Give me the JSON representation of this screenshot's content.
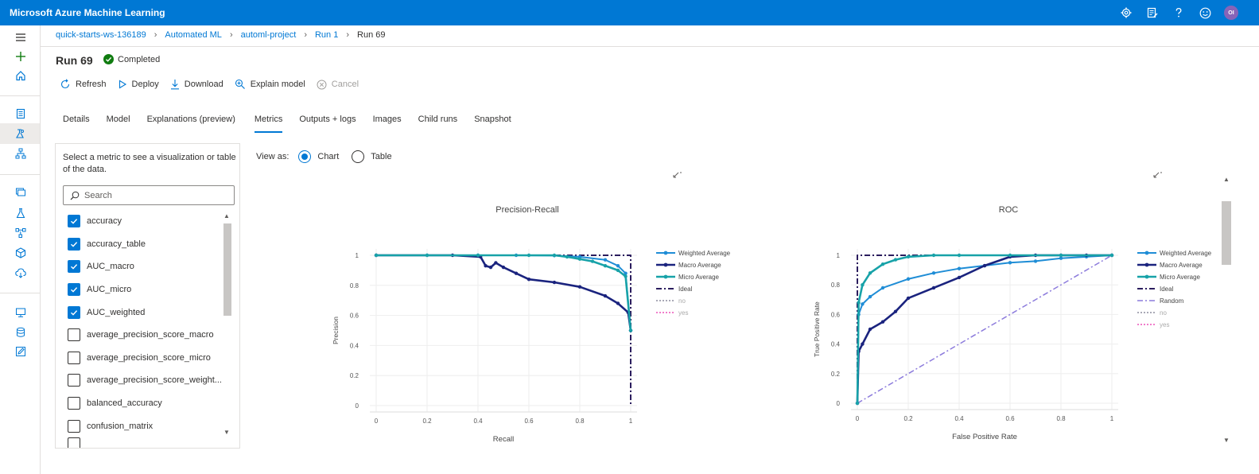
{
  "app": {
    "title": "Microsoft Azure Machine Learning",
    "avatar_initials": "OI"
  },
  "breadcrumb": [
    "quick-starts-ws-136189",
    "Automated ML",
    "automl-project",
    "Run 1",
    "Run 69"
  ],
  "run": {
    "title": "Run 69",
    "status": "Completed"
  },
  "toolbar": {
    "refresh": "Refresh",
    "deploy": "Deploy",
    "download": "Download",
    "explain": "Explain model",
    "cancel": "Cancel"
  },
  "tabs": [
    "Details",
    "Model",
    "Explanations (preview)",
    "Metrics",
    "Outputs + logs",
    "Images",
    "Child runs",
    "Snapshot"
  ],
  "selected_tab": "Metrics",
  "metrics_panel": {
    "description": "Select a metric to see a visualization or table of the data.",
    "search_placeholder": "Search",
    "items": [
      {
        "label": "accuracy",
        "checked": true
      },
      {
        "label": "accuracy_table",
        "checked": true
      },
      {
        "label": "AUC_macro",
        "checked": true
      },
      {
        "label": "AUC_micro",
        "checked": true
      },
      {
        "label": "AUC_weighted",
        "checked": true
      },
      {
        "label": "average_precision_score_macro",
        "checked": false
      },
      {
        "label": "average_precision_score_micro",
        "checked": false
      },
      {
        "label": "average_precision_score_weight...",
        "checked": false
      },
      {
        "label": "balanced_accuracy",
        "checked": false
      },
      {
        "label": "confusion_matrix",
        "checked": false
      }
    ]
  },
  "view_as": {
    "label": "View as:",
    "chart": "Chart",
    "table": "Table",
    "selected": "Chart"
  },
  "colors": {
    "weighted": "#1f8dd6",
    "macro": "#1a237e",
    "micro": "#17a2a8",
    "ideal": "#2b1d5e",
    "random": "#8c7bdc",
    "no": "#a9a9b6",
    "yes": "#f07ecb",
    "accent": "#0078d4"
  },
  "chart_data": [
    {
      "type": "line",
      "title": "Precision-Recall",
      "xlabel": "Recall",
      "ylabel": "Precision",
      "xlim": [
        0,
        1
      ],
      "ylim": [
        0,
        1
      ],
      "xticks": [
        "0",
        "0.2",
        "0.4",
        "0.6",
        "0.8",
        "1"
      ],
      "yticks": [
        "0",
        "0.2",
        "0.4",
        "0.6",
        "0.8",
        "1"
      ],
      "legend_position": "right",
      "series": [
        {
          "name": "Weighted Average",
          "x": [
            0,
            0.2,
            0.4,
            0.55,
            0.7,
            0.8,
            0.9,
            0.95,
            0.98,
            1.0
          ],
          "y": [
            1,
            1,
            1,
            1,
            0.998,
            0.99,
            0.97,
            0.93,
            0.88,
            0.5
          ]
        },
        {
          "name": "Macro Average",
          "x": [
            0,
            0.3,
            0.41,
            0.43,
            0.45,
            0.47,
            0.5,
            0.55,
            0.6,
            0.7,
            0.8,
            0.9,
            0.95,
            0.99,
            1.0
          ],
          "y": [
            1,
            1,
            0.99,
            0.93,
            0.92,
            0.95,
            0.92,
            0.88,
            0.84,
            0.82,
            0.79,
            0.73,
            0.68,
            0.62,
            0.5
          ]
        },
        {
          "name": "Micro Average",
          "x": [
            0,
            0.2,
            0.4,
            0.6,
            0.7,
            0.75,
            0.8,
            0.85,
            0.9,
            0.95,
            0.98,
            1.0
          ],
          "y": [
            1,
            1,
            1,
            1,
            1,
            0.99,
            0.975,
            0.96,
            0.93,
            0.9,
            0.86,
            0.5
          ]
        },
        {
          "name": "Ideal",
          "x": [
            0,
            1,
            1
          ],
          "y": [
            1,
            1,
            0
          ]
        },
        {
          "name": "no",
          "x": [],
          "y": []
        },
        {
          "name": "yes",
          "x": [],
          "y": []
        }
      ]
    },
    {
      "type": "line",
      "title": "ROC",
      "xlabel": "False Positive Rate",
      "ylabel": "True Positive Rate",
      "xlim": [
        0,
        1
      ],
      "ylim": [
        0,
        1
      ],
      "xticks": [
        "0",
        "0.2",
        "0.4",
        "0.6",
        "0.8",
        "1"
      ],
      "yticks": [
        "0",
        "0.2",
        "0.4",
        "0.6",
        "0.8",
        "1"
      ],
      "legend_position": "right",
      "series": [
        {
          "name": "Weighted Average",
          "x": [
            0,
            0.005,
            0.02,
            0.05,
            0.1,
            0.2,
            0.3,
            0.4,
            0.5,
            0.6,
            0.7,
            0.8,
            0.9,
            1.0
          ],
          "y": [
            0,
            0.6,
            0.67,
            0.72,
            0.78,
            0.84,
            0.88,
            0.91,
            0.93,
            0.95,
            0.96,
            0.98,
            0.99,
            1.0
          ]
        },
        {
          "name": "Macro Average",
          "x": [
            0,
            0.005,
            0.02,
            0.05,
            0.1,
            0.15,
            0.2,
            0.3,
            0.4,
            0.5,
            0.6,
            0.7,
            0.8,
            0.9,
            1.0
          ],
          "y": [
            0,
            0.35,
            0.4,
            0.5,
            0.55,
            0.62,
            0.71,
            0.78,
            0.85,
            0.93,
            0.99,
            1.0,
            1.0,
            1.0,
            1.0
          ]
        },
        {
          "name": "Micro Average",
          "x": [
            0,
            0.005,
            0.02,
            0.05,
            0.1,
            0.15,
            0.2,
            0.3,
            0.4,
            0.6,
            0.8,
            1.0
          ],
          "y": [
            0,
            0.68,
            0.8,
            0.88,
            0.94,
            0.97,
            0.99,
            1.0,
            1.0,
            1.0,
            1.0,
            1.0
          ]
        },
        {
          "name": "Ideal",
          "x": [
            0,
            0,
            1
          ],
          "y": [
            0,
            1,
            1
          ]
        },
        {
          "name": "Random",
          "x": [
            0,
            1
          ],
          "y": [
            0,
            1
          ]
        },
        {
          "name": "no",
          "x": [],
          "y": []
        },
        {
          "name": "yes",
          "x": [],
          "y": []
        }
      ]
    }
  ]
}
